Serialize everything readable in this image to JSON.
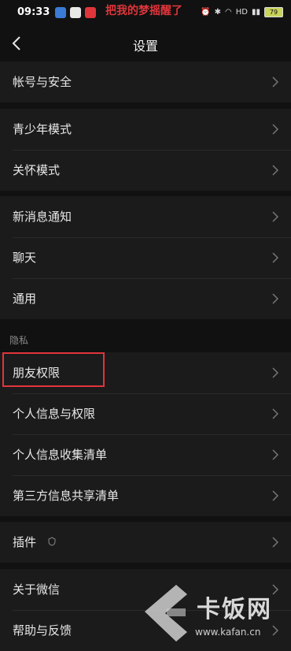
{
  "status": {
    "time": "09:33",
    "notification": "把我的梦摇醒了",
    "battery": "79"
  },
  "nav": {
    "title": "设置"
  },
  "groups": {
    "g1": [
      "帐号与安全"
    ],
    "g2": [
      "青少年模式",
      "关怀模式"
    ],
    "g3": [
      "新消息通知",
      "聊天",
      "通用"
    ],
    "privacy_title": "隐私",
    "g4": [
      "朋友权限",
      "个人信息与权限",
      "个人信息收集清单",
      "第三方信息共享清单"
    ],
    "g5": [
      "插件"
    ],
    "g6": [
      "关于微信",
      "帮助与反馈"
    ]
  },
  "watermark": {
    "brand": "卡饭网",
    "url": "www.kafan.cn"
  }
}
